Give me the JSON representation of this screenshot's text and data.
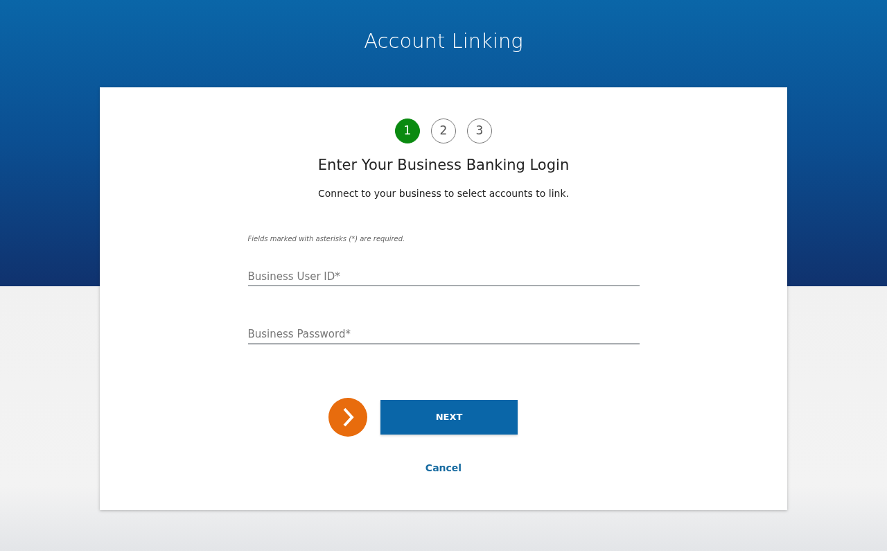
{
  "header": {
    "title": "Account Linking"
  },
  "steps": [
    {
      "label": "1",
      "selected": true
    },
    {
      "label": "2",
      "selected": false
    },
    {
      "label": "3",
      "selected": false
    }
  ],
  "heading": "Enter Your Business Banking Login",
  "subheading": "Connect to your business to select accounts to link.",
  "required_note": "Fields marked with asterisks (*) are required.",
  "fields": [
    {
      "placeholder": "Business User ID*"
    },
    {
      "placeholder": "Business Password*"
    }
  ],
  "buttons": {
    "next": "NEXT",
    "cancel": "Cancel"
  }
}
